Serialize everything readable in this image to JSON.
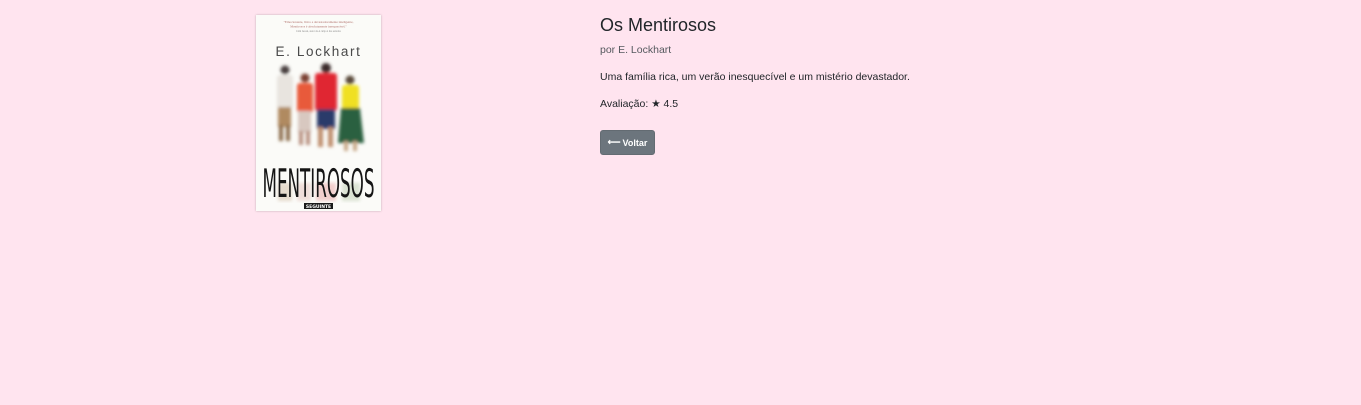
{
  "book": {
    "title": "Os Mentirosos",
    "author_line": "por E. Lockhart",
    "description": "Uma família rica, um verão inesquecível e um mistério devastador.",
    "rating_label": "Avaliação:",
    "rating_star": "★",
    "rating_value": "4.5"
  },
  "cover": {
    "quote_line1": "\"Emocionante, lírico e devastadoramente inteligente,",
    "quote_line2": "Mentirosos é absolutamente inesquecível.\"",
    "quote_line3": "John Green, autor de A culpa é das estrelas",
    "author": "E. Lockhart",
    "title": "MENTIROSOS",
    "publisher": "SEGUINTE"
  },
  "actions": {
    "back_arrow": "⟵",
    "back_label": "Voltar"
  },
  "colors": {
    "background": "#ffe4ef",
    "button": "#6c757d"
  }
}
